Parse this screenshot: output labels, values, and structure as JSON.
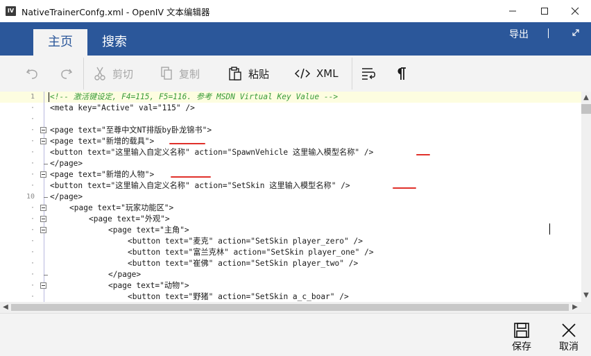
{
  "window": {
    "title": "NativeTrainerConfg.xml - OpenIV 文本编辑器",
    "app_icon_text": "IV"
  },
  "ribbon": {
    "tabs": [
      {
        "label": "主页",
        "active": true
      },
      {
        "label": "搜索",
        "active": false
      }
    ],
    "export_label": "导出"
  },
  "toolbar": {
    "undo_icon": "undo-icon",
    "redo_icon": "redo-icon",
    "cut_label": "剪切",
    "copy_label": "复制",
    "paste_label": "粘贴",
    "xml_label": "XML"
  },
  "editor": {
    "line_numbers": [
      "1",
      "·",
      "·",
      "·",
      "·",
      "·",
      "·",
      "·",
      "·",
      "10",
      "·",
      "·",
      "·",
      "·",
      "·",
      "·",
      "·",
      "·",
      "·"
    ],
    "lines": [
      {
        "indent": 0,
        "text": "<!-- 激活键设定, F4=115, F5=116. 参考 MSDN Virtual Key Value -->",
        "comment": true
      },
      {
        "indent": 0,
        "text": "<meta key=\"Active\" val=\"115\" />"
      },
      {
        "indent": 0,
        "text": ""
      },
      {
        "indent": 0,
        "text": "<page text=\"至尊中文NT排版by卧龙锦书\">"
      },
      {
        "indent": 0,
        "text": "<page text=\"新增的载具\">"
      },
      {
        "indent": 0,
        "text": "<button text=\"这里输入自定义名称\" action=\"SpawnVehicle 这里输入模型名称\" />"
      },
      {
        "indent": 0,
        "text": "</page>"
      },
      {
        "indent": 0,
        "text": "<page text=\"新增的人物\">"
      },
      {
        "indent": 0,
        "text": "<button text=\"这里输入自定义名称\" action=\"SetSkin 这里输入模型名称\" />"
      },
      {
        "indent": 0,
        "text": "</page>"
      },
      {
        "indent": 1,
        "text": "<page text=\"玩家功能区\">"
      },
      {
        "indent": 2,
        "text": "<page text=\"外观\">"
      },
      {
        "indent": 3,
        "text": "<page text=\"主角\">"
      },
      {
        "indent": 4,
        "text": "<button text=\"麦克\" action=\"SetSkin player_zero\" />"
      },
      {
        "indent": 4,
        "text": "<button text=\"富兰克林\" action=\"SetSkin player_one\" />"
      },
      {
        "indent": 4,
        "text": "<button text=\"崔佛\" action=\"SetSkin player_two\" />"
      },
      {
        "indent": 3,
        "text": "</page>"
      },
      {
        "indent": 3,
        "text": "<page text=\"动物\">"
      },
      {
        "indent": 4,
        "text": "<button text=\"野猪\" action=\"SetSkin a_c_boar\" />"
      }
    ]
  },
  "footer": {
    "save_label": "保存",
    "cancel_label": "取消"
  }
}
